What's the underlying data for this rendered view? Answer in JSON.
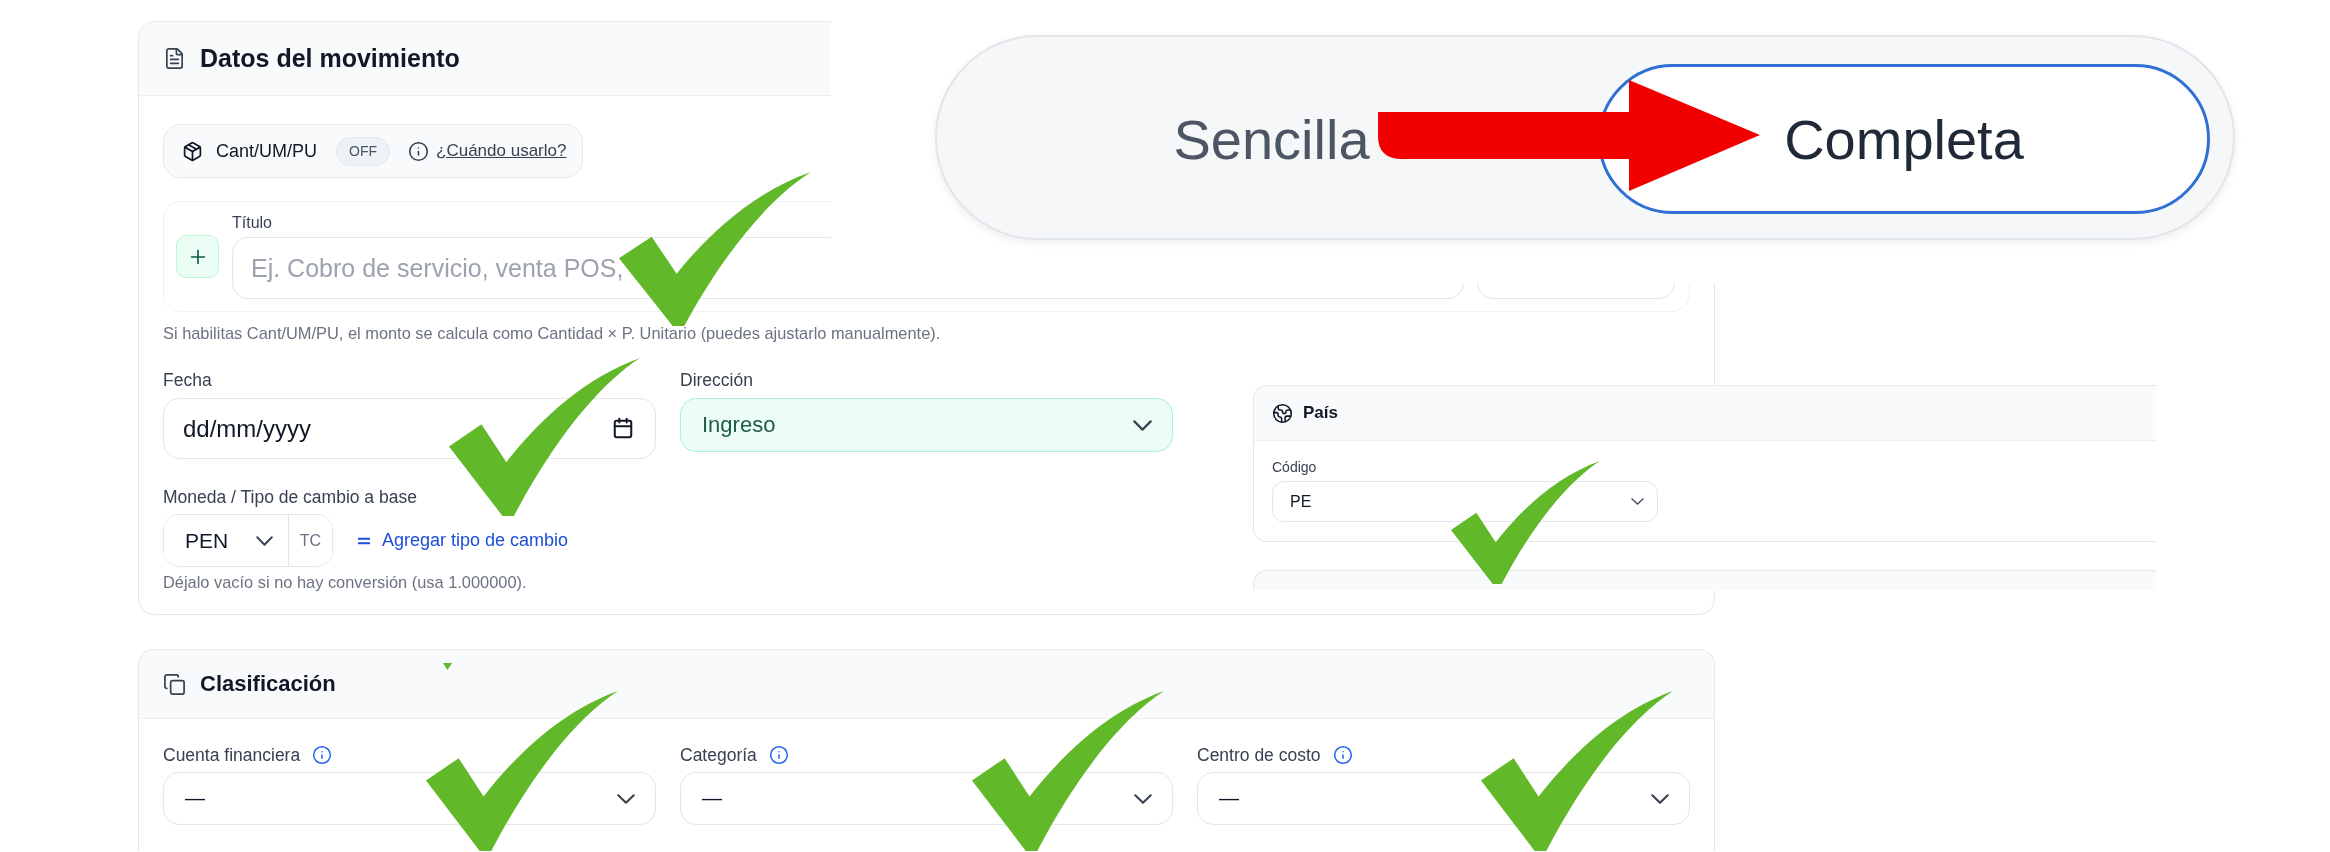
{
  "movement_card": {
    "title": "Datos del movimiento",
    "quantity_toggle": {
      "label": "Cant/UM/PU",
      "badge": "OFF",
      "on": false,
      "help_link": "¿Cuándo usarlo?"
    },
    "title_field": {
      "label": "Título",
      "placeholder": "Ej. Cobro de servicio, venta POS,"
    },
    "hint": "Si habilitas Cant/UM/PU, el monto se calcula como Cantidad × P. Unitario (puedes ajustarlo manualmente).",
    "fields": [
      {
        "kind": "date",
        "label": "Fecha",
        "placeholder": "dd/mm/yyyy"
      },
      {
        "kind": "direction",
        "label": "Dirección",
        "value": "Ingreso"
      }
    ],
    "currency": {
      "label": "Moneda / Tipo de cambio a base",
      "value": "PEN",
      "rate_field": {
        "placeholder": "TC"
      },
      "add_rate_link": "Agregar tipo de cambio",
      "hint": "Déjalo vacío si no hay conversión (usa 1.000000)."
    }
  },
  "mode_switch": {
    "options": [
      {
        "label": "Sencilla",
        "selected": false
      },
      {
        "label": "Completa",
        "selected": true
      }
    ]
  },
  "country_panel": {
    "title": "País",
    "fields": [
      {
        "label": "Código",
        "value": "PE"
      }
    ]
  },
  "classification_card": {
    "title": "Clasificación",
    "fields": [
      {
        "label": "Cuenta financiera",
        "value": "—"
      },
      {
        "label": "Categoría",
        "value": "—"
      },
      {
        "label": "Centro de costo",
        "value": "—"
      }
    ]
  }
}
